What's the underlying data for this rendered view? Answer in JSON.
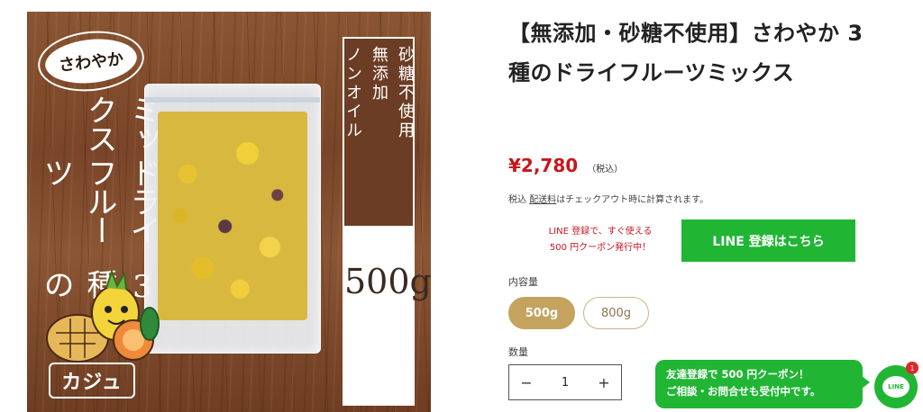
{
  "product_image": {
    "badge_text": "さわやか",
    "headline_lines": [
      "3種の",
      "ドライフルーツ",
      "ミックス"
    ],
    "panel_columns": [
      "砂糖不使用",
      "無添加",
      "ノンオイル"
    ],
    "weight_text": "500g",
    "brand_logo_text": "カジュ"
  },
  "product": {
    "title": "【無添加・砂糖不使用】さわやか 3種のドライフルーツミックス",
    "price": "¥2,780",
    "tax_label": "（税込）",
    "shipping_prefix": "税込",
    "shipping_link": "配送料",
    "shipping_suffix": "はチェックアウト時に計算されます。"
  },
  "line_promo": {
    "line1": "LINE 登録で、すぐ使える",
    "line2": "500 円クーポン発行中！",
    "button_label": "LINE 登録はこちら"
  },
  "variants": {
    "label": "内容量",
    "options": [
      "500g",
      "800g"
    ],
    "selected": "500g"
  },
  "quantity": {
    "label": "数量",
    "value": "1",
    "minus": "−",
    "plus": "+"
  },
  "chat": {
    "line1": "友達登録で 500 円クーポン！",
    "line2": "ご相談・お問合せも受付中です。",
    "fab_label": "LINE",
    "badge_count": "1"
  },
  "colors": {
    "price": "#c8161d",
    "line_green": "#21b534",
    "variant_gold": "#c4a35f"
  }
}
